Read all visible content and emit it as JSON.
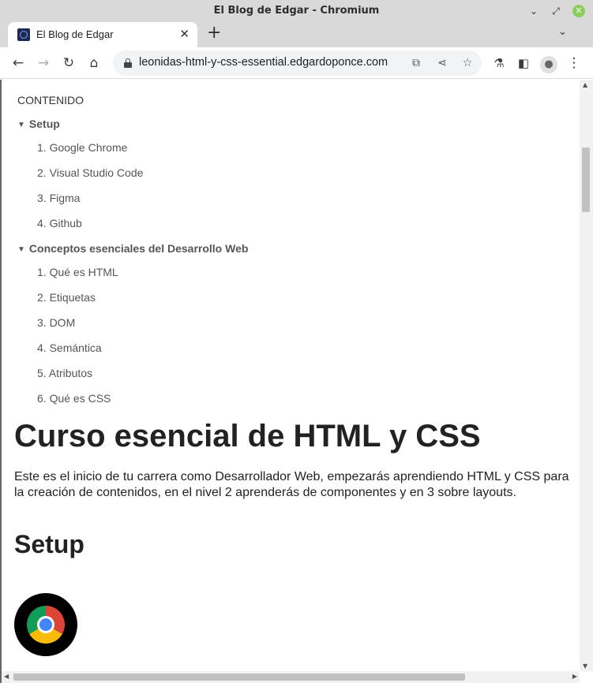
{
  "window": {
    "title": "El Blog de Edgar - Chromium"
  },
  "tab": {
    "title": "El Blog de Edgar"
  },
  "toolbar": {
    "url": "leonidas-html-y-css-essential.edgardoponce.com"
  },
  "toc": {
    "heading": "CONTENIDO",
    "sections": [
      {
        "title": "Setup",
        "items": [
          "1. Google Chrome",
          "2. Visual Studio Code",
          "3. Figma",
          "4. Github"
        ]
      },
      {
        "title": "Conceptos esenciales del Desarrollo Web",
        "items": [
          "1. Qué es HTML",
          "2. Etiquetas",
          "3. DOM",
          "4. Semántica",
          "5. Atributos",
          "6. Qué es CSS"
        ]
      }
    ]
  },
  "article": {
    "title": "Curso esencial de HTML y CSS",
    "intro": "Este es el inicio de tu carrera como Desarrollador Web, empezarás aprendiendo HTML y CSS para la creación de contenidos, en el nivel 2 aprenderás de componentes y en 3 sobre layouts.",
    "section_heading": "Setup",
    "logo_icon": "chrome-logo-icon"
  }
}
